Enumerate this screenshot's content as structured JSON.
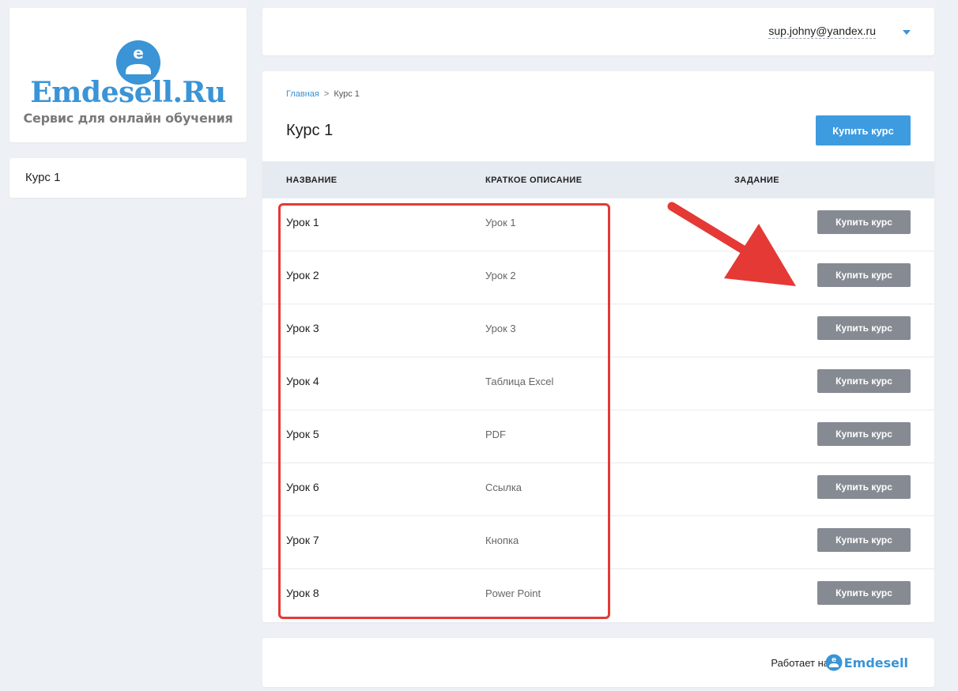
{
  "logo": {
    "title": "Emdesell.Ru",
    "tagline": "Сервис для онлайн обучения",
    "mark_letter": "e",
    "brand_color": "#3a94d6"
  },
  "sidebar": {
    "items": [
      {
        "label": "Курс 1"
      }
    ]
  },
  "header": {
    "user_email": "sup.johny@yandex.ru",
    "dropdown_icon": "caret-down-icon"
  },
  "breadcrumb": {
    "home": "Главная",
    "separator": ">",
    "current": "Курс 1"
  },
  "page": {
    "title": "Курс 1",
    "buy_button": "Купить курс",
    "accent_color": "#3d9be0"
  },
  "table": {
    "columns": [
      "НАЗВАНИЕ",
      "КРАТКОЕ ОПИСАНИЕ",
      "ЗАДАНИЕ"
    ],
    "rows": [
      {
        "name": "Урок 1",
        "description": "Урок 1",
        "action": "Купить курс"
      },
      {
        "name": "Урок 2",
        "description": "Урок 2",
        "action": "Купить курс"
      },
      {
        "name": "Урок 3",
        "description": "Урок 3",
        "action": "Купить курс"
      },
      {
        "name": "Урок 4",
        "description": "Таблица Excel",
        "action": "Купить курс"
      },
      {
        "name": "Урок 5",
        "description": "PDF",
        "action": "Купить курс"
      },
      {
        "name": "Урок 6",
        "description": "Ссылка",
        "action": "Купить курс"
      },
      {
        "name": "Урок 7",
        "description": "Кнопка",
        "action": "Купить курс"
      },
      {
        "name": "Урок 8",
        "description": "Power Point",
        "action": "Купить курс"
      }
    ]
  },
  "footer": {
    "powered_by": "Работает на",
    "brand": "Emdesell"
  },
  "annotation": {
    "color": "#e53935"
  }
}
